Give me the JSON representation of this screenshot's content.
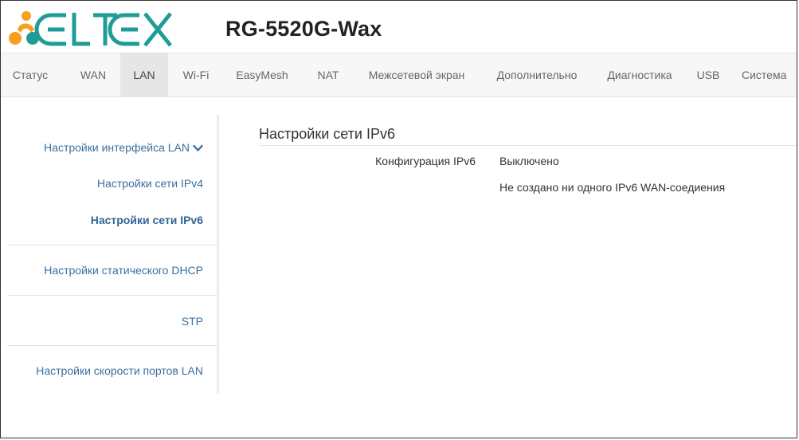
{
  "brand": {
    "logo_text": "ELTEX",
    "model": "RG-5520G-Wax",
    "colors": {
      "logo_orange": "#f5a01e",
      "logo_teal": "#1f9c96",
      "link_blue": "#3a6f9e"
    }
  },
  "nav": {
    "items": [
      {
        "label": "Статус"
      },
      {
        "label": "WAN"
      },
      {
        "label": "LAN",
        "active": true
      },
      {
        "label": "Wi-Fi"
      },
      {
        "label": "EasyMesh"
      },
      {
        "label": "NAT"
      },
      {
        "label": "Межсетевой экран"
      },
      {
        "label": "Дополнительно"
      },
      {
        "label": "Диагностика"
      },
      {
        "label": "USB"
      },
      {
        "label": "Система"
      }
    ]
  },
  "sidebar": {
    "group_label": "Настройки интерфейса LAN",
    "group_icon": "chevron-down-icon",
    "sub_items": [
      {
        "label": "Настройки сети IPv4"
      },
      {
        "label": "Настройки сети IPv6",
        "active": true
      }
    ],
    "items": [
      {
        "label": "Настройки статического DHCP"
      },
      {
        "label": "STP"
      },
      {
        "label": "Настройки скорости портов LAN"
      }
    ]
  },
  "content": {
    "title": "Настройки сети IPv6",
    "fields": [
      {
        "label": "Конфигурация IPv6",
        "value": "Выключено"
      }
    ],
    "note": "Не создано ни одного IPv6 WAN-соедиения"
  }
}
